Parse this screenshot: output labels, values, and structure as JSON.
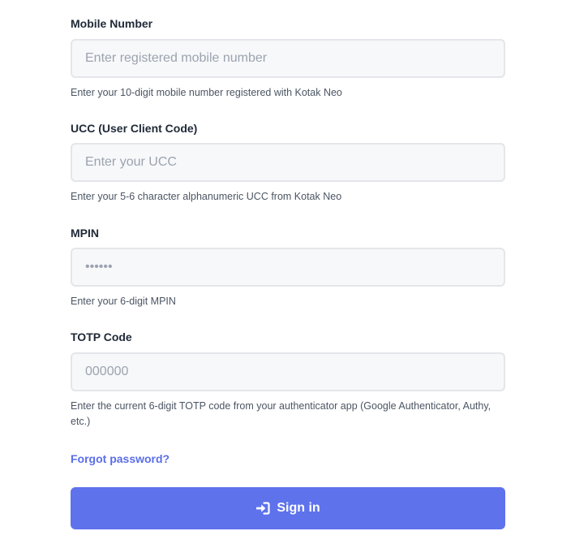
{
  "fields": {
    "mobile": {
      "label": "Mobile Number",
      "placeholder": "Enter registered mobile number",
      "help": "Enter your 10-digit mobile number registered with Kotak Neo"
    },
    "ucc": {
      "label": "UCC (User Client Code)",
      "placeholder": "Enter your UCC",
      "help": "Enter your 5-6 character alphanumeric UCC from Kotak Neo"
    },
    "mpin": {
      "label": "MPIN",
      "placeholder": "••••••",
      "help": "Enter your 6-digit MPIN"
    },
    "totp": {
      "label": "TOTP Code",
      "placeholder": "000000",
      "help": "Enter the current 6-digit TOTP code from your authenticator app (Google Authenticator, Authy, etc.)"
    }
  },
  "forgot_password": "Forgot password?",
  "sign_in": {
    "label": "Sign in",
    "icon": "sign-in-icon"
  },
  "colors": {
    "primary": "#5e72ec",
    "link": "#5b6ee8",
    "input_bg": "#f7f8fa",
    "input_border": "#e4e6ea"
  }
}
